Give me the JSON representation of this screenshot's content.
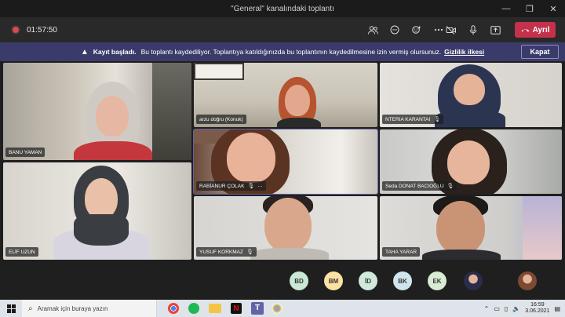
{
  "window": {
    "title": "\"General\" kanalındaki toplantı",
    "minimize": "—",
    "maximize": "❐",
    "close": "✕"
  },
  "toolbar": {
    "timer": "01:57:50",
    "leave_label": "Ayrıl",
    "icons": [
      "people-icon",
      "chat-icon",
      "reactions-icon",
      "more-options-icon",
      "camera-off-icon",
      "microphone-icon",
      "share-icon"
    ]
  },
  "banner": {
    "title": "Kayıt başladı.",
    "message": "Bu toplantı kaydediliyor. Toplantıya katıldığınızda bu toplantının kaydedilmesine izin vermiş olursunuz.",
    "link": "Gizlilik ilkesi",
    "dismiss": "Kapat"
  },
  "participants": [
    {
      "name": "BANU YAMAN",
      "muted": false
    },
    {
      "name": "arzu doğru (Konuk)",
      "muted": false
    },
    {
      "name": "NTERIA KARANTAI",
      "muted": true
    },
    {
      "name": "RABİANUR ÇOLAK",
      "muted": true,
      "more": "···"
    },
    {
      "name": "Seda DONAT BACIOĞLU",
      "muted": true
    },
    {
      "name": "ELİF UZUN",
      "muted": false
    },
    {
      "name": "YUSUF KORKMAZ",
      "muted": true
    },
    {
      "name": "TAHA YARAR",
      "muted": false
    }
  ],
  "avatars": [
    {
      "initials": "BD",
      "color": "#c9e8d5"
    },
    {
      "initials": "BM",
      "color": "#fde0a4"
    },
    {
      "initials": "İD",
      "color": "#cfeadb"
    },
    {
      "initials": "BK",
      "color": "#cfe6ef"
    },
    {
      "initials": "EK",
      "color": "#d8ecd3"
    }
  ],
  "taskbar": {
    "search_placeholder": "Aramak için buraya yazın",
    "time": "16:59",
    "date": "3.06.2021"
  }
}
